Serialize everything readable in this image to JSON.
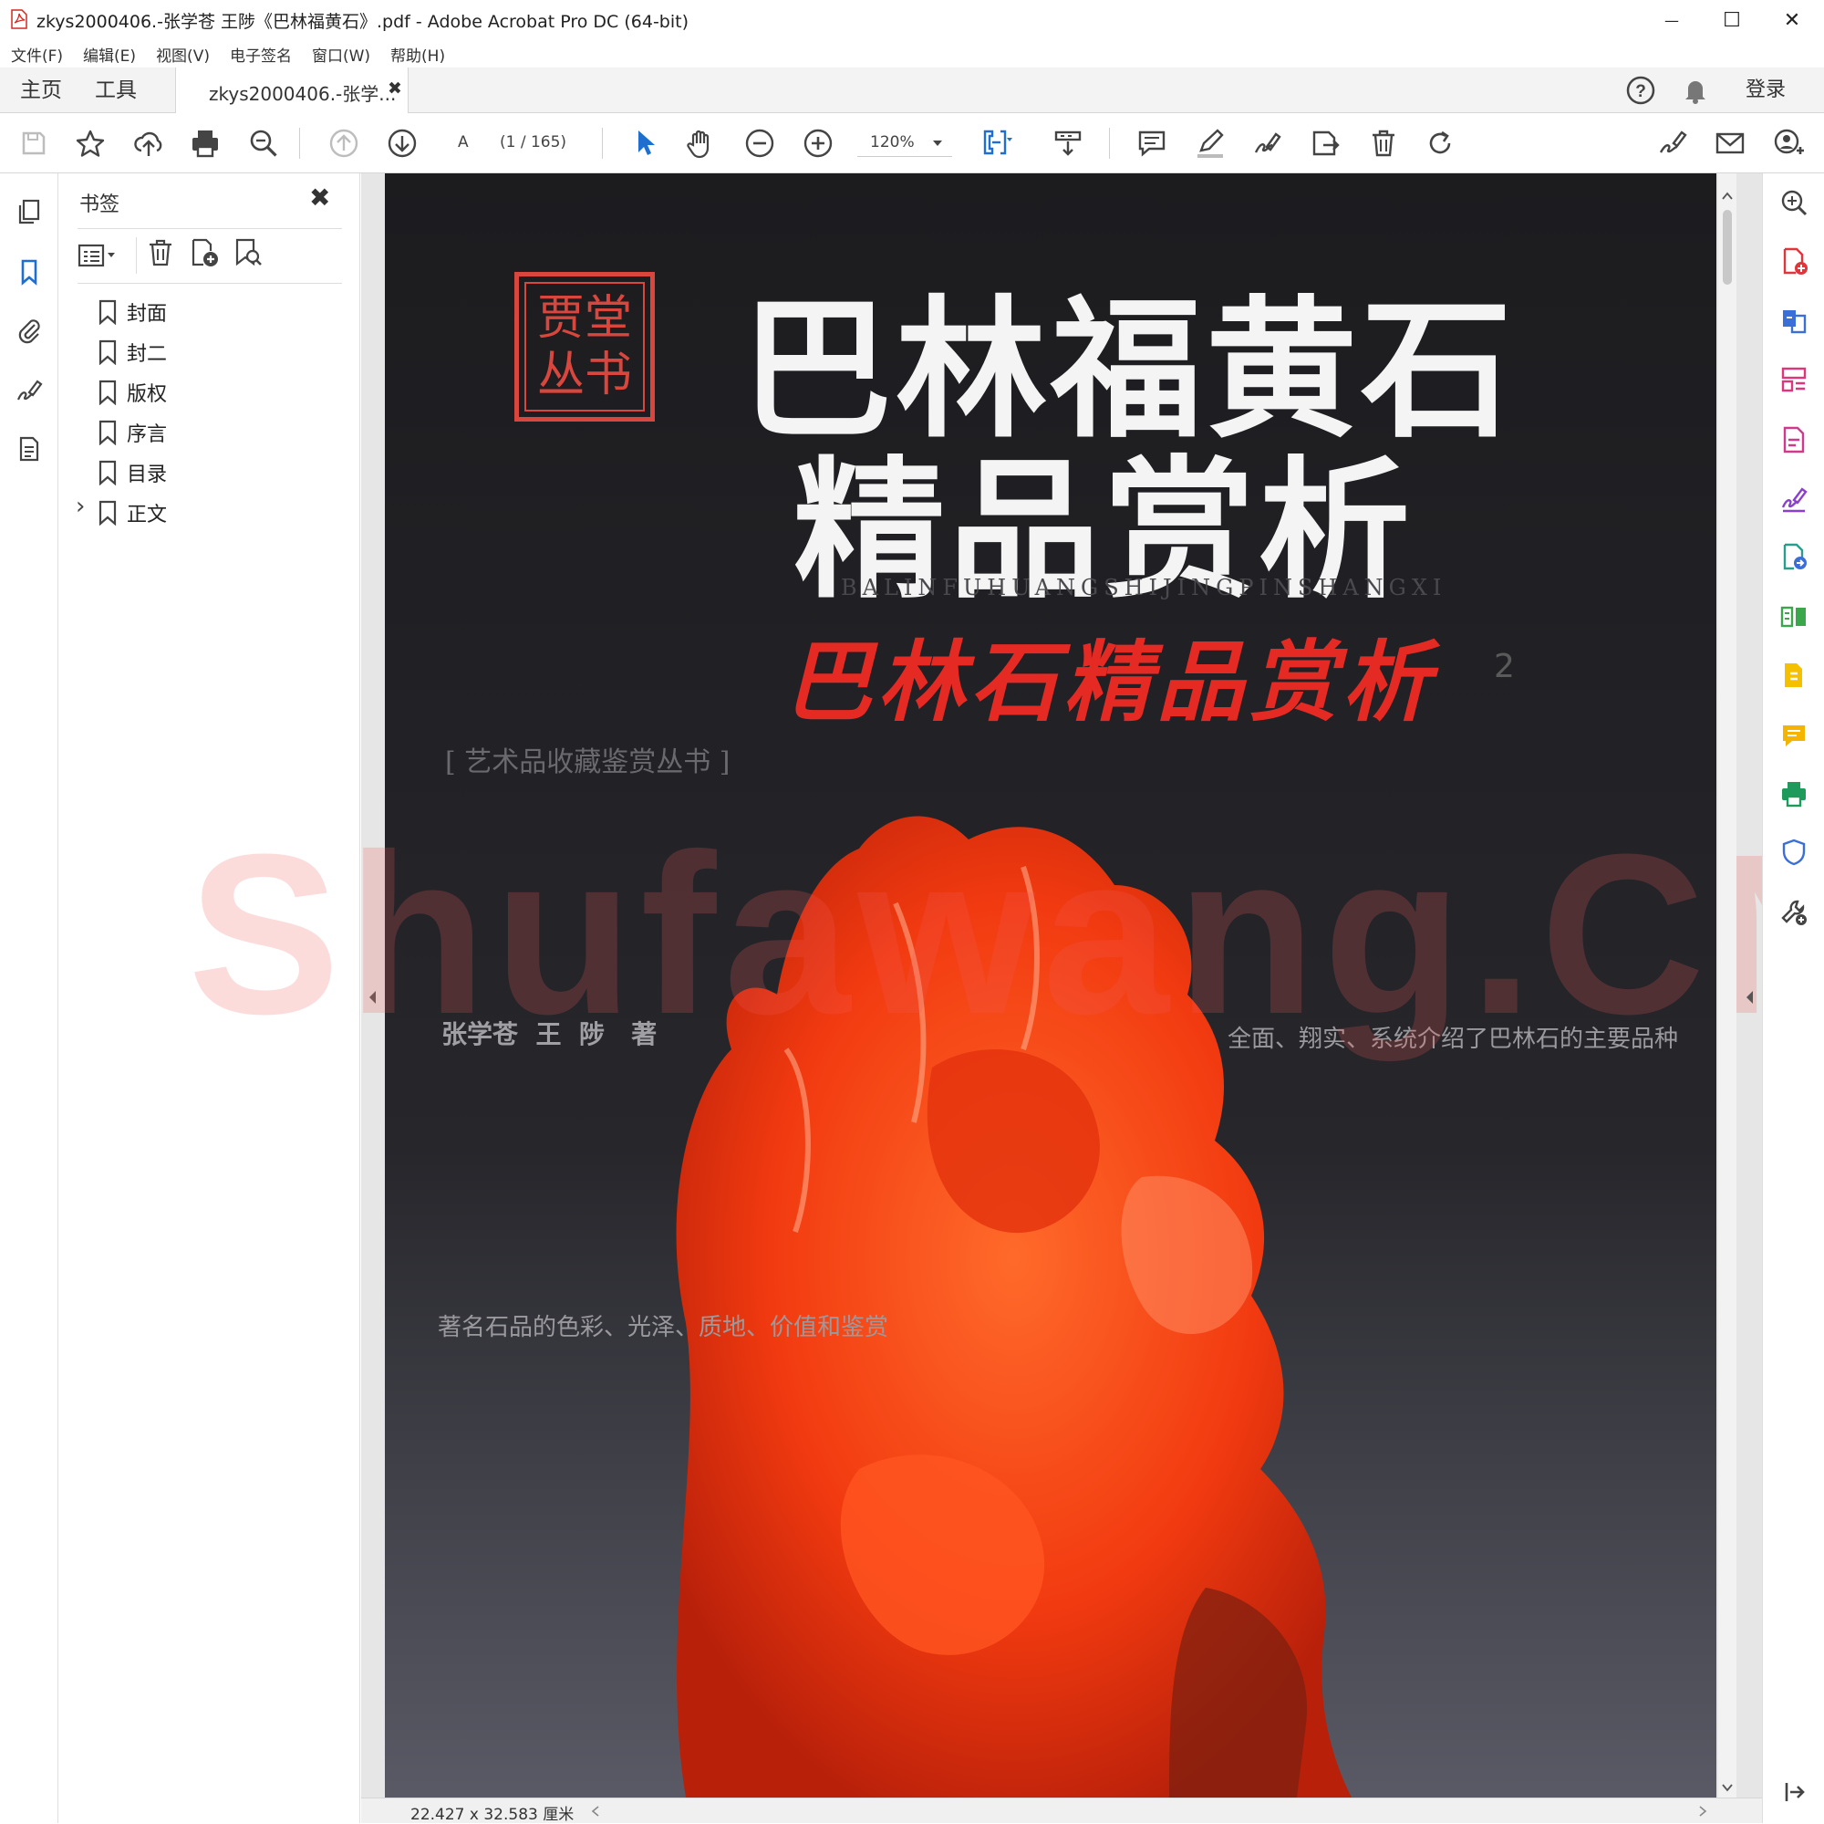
{
  "window": {
    "title": "zkys2000406.-张学苍 王陟《巴林福黄石》.pdf - Adobe Acrobat Pro DC (64-bit)",
    "controls": {
      "minimize": "—",
      "maximize": "☐",
      "close": "✕"
    }
  },
  "menu": [
    "文件(F)",
    "编辑(E)",
    "视图(V)",
    "电子签名",
    "窗口(W)",
    "帮助(H)"
  ],
  "tabs": {
    "home": "主页",
    "tools": "工具",
    "document": "zkys2000406.-张学...",
    "document_close": "✖",
    "sign_in": "登录"
  },
  "toolbar": {
    "page_label": "A",
    "page_indicator": "(1 / 165)",
    "zoom": "120%"
  },
  "bookmarks": {
    "title": "书签",
    "close": "✖",
    "items": [
      {
        "label": "封面",
        "expandable": false
      },
      {
        "label": "封二",
        "expandable": false
      },
      {
        "label": "版权",
        "expandable": false
      },
      {
        "label": "序言",
        "expandable": false
      },
      {
        "label": "目录",
        "expandable": false
      },
      {
        "label": "正文",
        "expandable": true
      }
    ],
    "expand_glyph": "›"
  },
  "cover": {
    "seal_text": "贾堂丛书",
    "title_line1": "巴林福黄石",
    "title_line2": "精品赏析",
    "pinyin": "BALINFUHUANGSHIJINGPINSHANGXI",
    "subtitle": "巴林石精品赏析",
    "subtitle_number": "2",
    "series": "[ 艺术品收藏鉴赏丛书 ]",
    "authors": "张学苍  王  陟   著",
    "tagline": "全面、翔实、系统介绍了巴林石的主要品种",
    "caption": "著名石品的色彩、光泽、质地、价值和鉴赏"
  },
  "watermark": "Shufawang.CN",
  "status": {
    "dimensions": "22.427 x 32.583 厘米"
  },
  "colors": {
    "accent": "#1f6fd1",
    "cover_bg": "#1e1e21",
    "stone": "#ff4a14",
    "seal": "#d8463e"
  }
}
